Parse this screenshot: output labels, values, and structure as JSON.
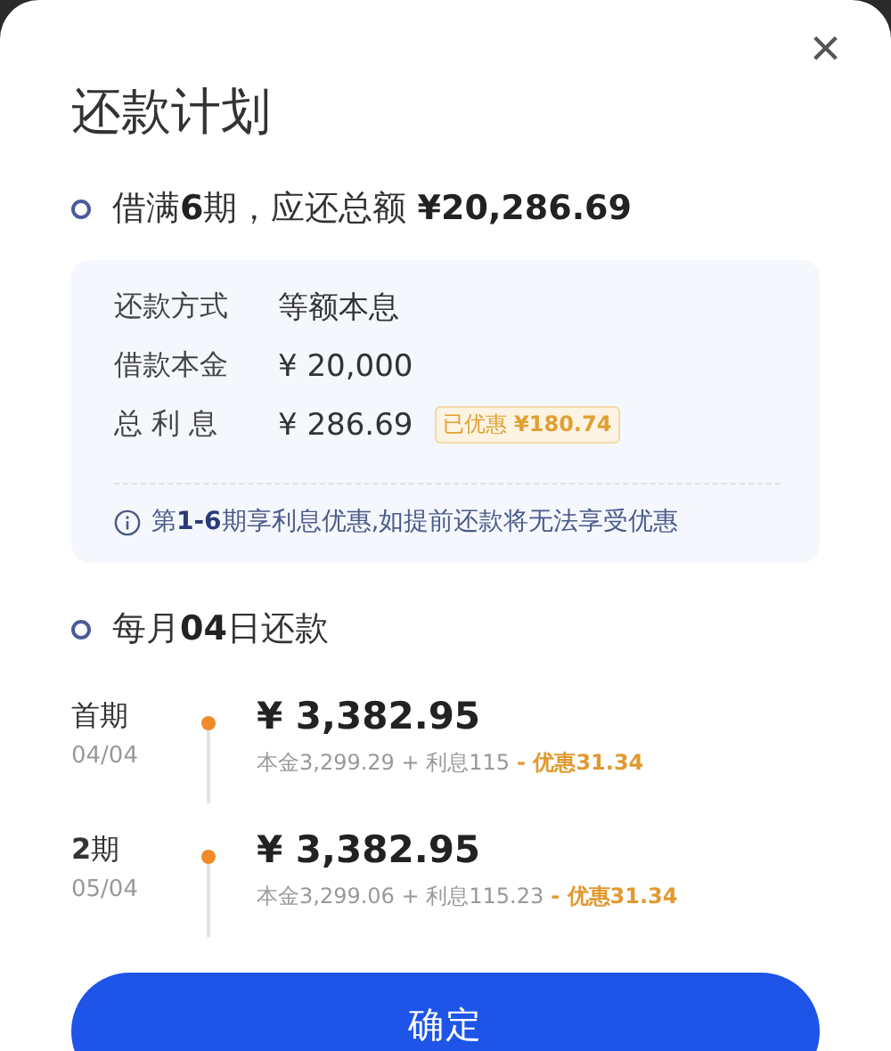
{
  "sheet": {
    "title": "还款计划",
    "close": "×"
  },
  "summary": "借满**6**期，应还总额 **¥20,286.69**",
  "details": [
    {
      "label": "还款方式",
      "value": "等额本息"
    },
    {
      "label": "借款本金",
      "value": "¥ 20,000"
    },
    {
      "label": "总 利 息",
      "value": "¥ 286.69",
      "badge": "已优惠 **¥180.74**"
    }
  ],
  "note": "第**1-6**期享利息优惠,如提前还款将无法享受优惠",
  "schedule_heading": "每月**04**日还款",
  "installments": [
    {
      "period": "首期",
      "date": "04/04",
      "amount": "¥ 3,382.95",
      "breakdown": "本金3,299.29 + 利息115",
      "discount": "- 优惠31.34"
    },
    {
      "period": "**2**期",
      "date": "05/04",
      "amount": "¥ 3,382.95",
      "breakdown": "本金3,299.06 + 利息115.23",
      "discount": "- 优惠31.34"
    }
  ],
  "confirm_button": "确定"
}
